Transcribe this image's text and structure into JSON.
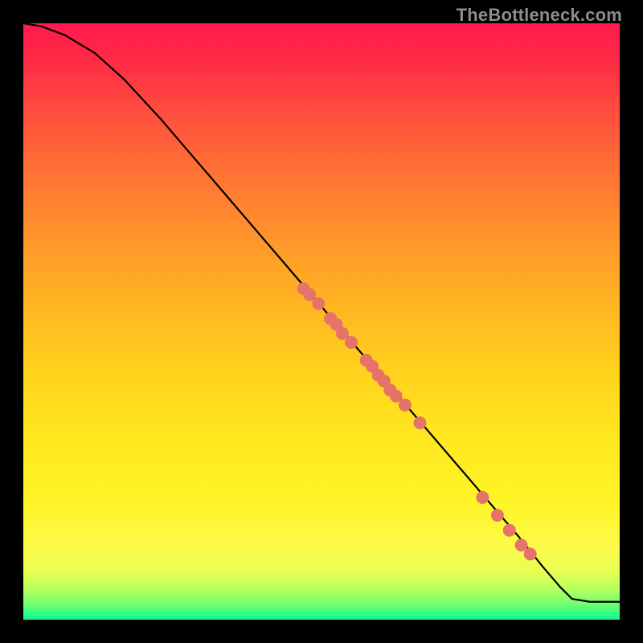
{
  "attribution": "TheBottleneck.com",
  "chart_data": {
    "type": "line",
    "title": "",
    "xlabel": "",
    "ylabel": "",
    "xlim": [
      0,
      100
    ],
    "ylim": [
      0,
      100
    ],
    "grid": false,
    "legend": false,
    "background_gradient": {
      "top": "#ff1a4d",
      "bottom": "#18f08a",
      "description": "red→orange→yellow→green vertical gradient"
    },
    "series": [
      {
        "name": "curve",
        "color": "#000000",
        "x": [
          0,
          3,
          7,
          12,
          17,
          23,
          29,
          35,
          41,
          47,
          53,
          59,
          65,
          71,
          77,
          83,
          87,
          90,
          92,
          95,
          100
        ],
        "y": [
          100,
          99.5,
          98,
          95,
          90.5,
          84,
          77,
          70,
          63,
          56,
          49,
          42,
          35,
          28,
          21,
          14,
          9,
          5.5,
          3.5,
          3,
          3
        ]
      }
    ],
    "points": [
      {
        "name": "cluster-a-1",
        "x": 47,
        "y": 55.5
      },
      {
        "name": "cluster-a-2",
        "x": 48,
        "y": 54.5
      },
      {
        "name": "cluster-a-3",
        "x": 49.5,
        "y": 53
      },
      {
        "name": "cluster-b-1",
        "x": 51.5,
        "y": 50.5
      },
      {
        "name": "cluster-b-2",
        "x": 52.5,
        "y": 49.5
      },
      {
        "name": "cluster-b-3",
        "x": 53.5,
        "y": 48
      },
      {
        "name": "cluster-b-4",
        "x": 55,
        "y": 46.5
      },
      {
        "name": "cluster-c-1",
        "x": 57.5,
        "y": 43.5
      },
      {
        "name": "cluster-c-2",
        "x": 58.5,
        "y": 42.5
      },
      {
        "name": "cluster-c-3",
        "x": 59.5,
        "y": 41
      },
      {
        "name": "cluster-c-4",
        "x": 60.5,
        "y": 40
      },
      {
        "name": "cluster-c-5",
        "x": 61.5,
        "y": 38.5
      },
      {
        "name": "cluster-c-6",
        "x": 62.5,
        "y": 37.5
      },
      {
        "name": "cluster-c-7",
        "x": 64,
        "y": 36
      },
      {
        "name": "cluster-d-1",
        "x": 66.5,
        "y": 33
      },
      {
        "name": "cluster-e-1",
        "x": 77,
        "y": 20.5
      },
      {
        "name": "cluster-e-2",
        "x": 79.5,
        "y": 17.5
      },
      {
        "name": "cluster-e-3",
        "x": 81.5,
        "y": 15
      },
      {
        "name": "cluster-e-4",
        "x": 83.5,
        "y": 12.5
      },
      {
        "name": "cluster-e-5",
        "x": 85,
        "y": 11
      }
    ],
    "point_style": {
      "color": "#e57368",
      "radius_px": 8
    }
  }
}
